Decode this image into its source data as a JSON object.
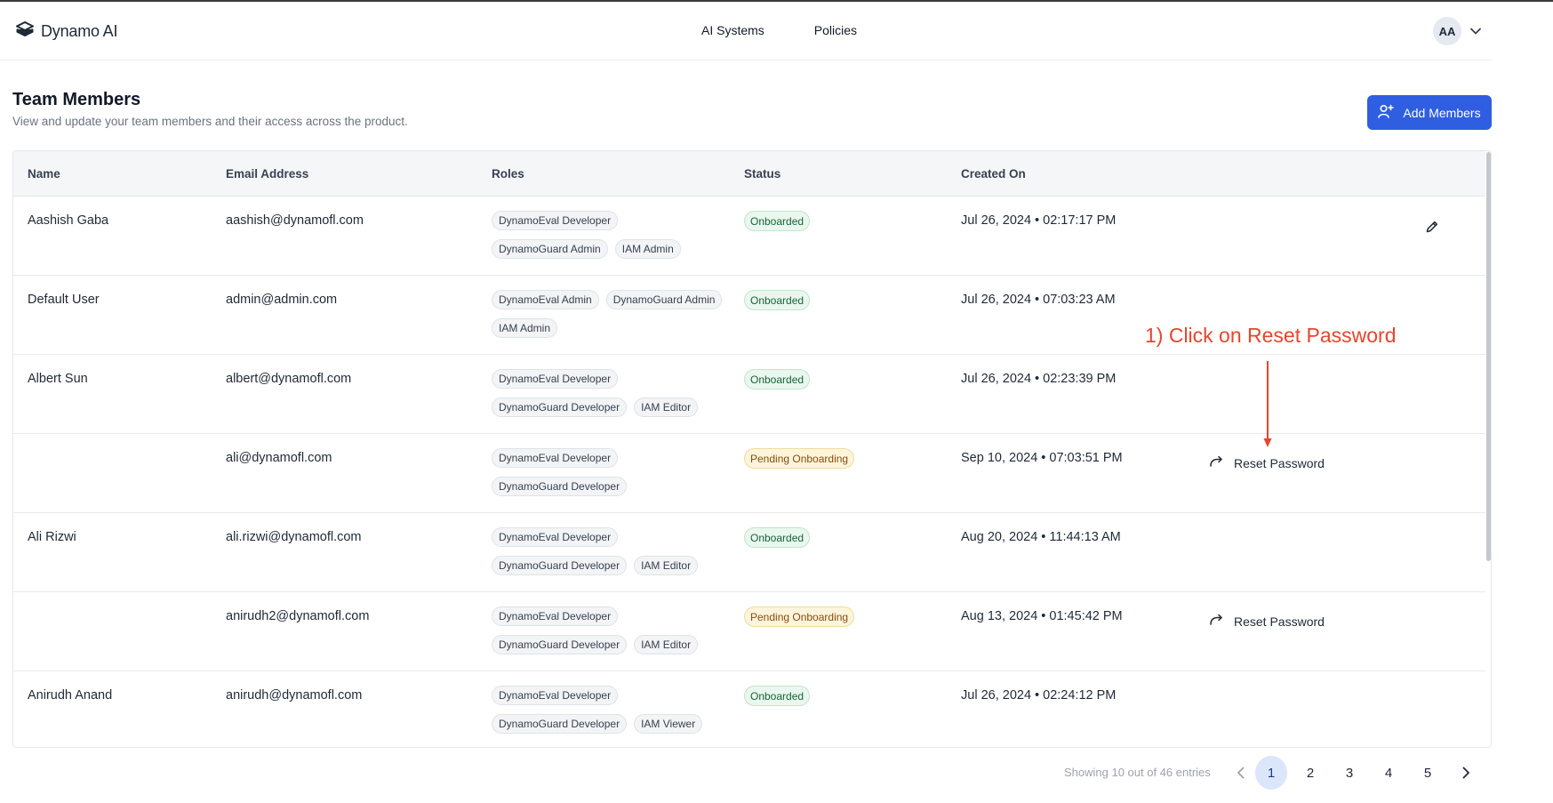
{
  "header": {
    "brand": "Dynamo AI",
    "nav": [
      "AI Systems",
      "Policies"
    ],
    "user_initials": "AA"
  },
  "page": {
    "title": "Team Members",
    "subtitle": "View and update your team members and their access across the product.",
    "add_button": "Add Members"
  },
  "table": {
    "columns": [
      "Name",
      "Email Address",
      "Roles",
      "Status",
      "Created On"
    ],
    "rows": [
      {
        "name": "Aashish Gaba",
        "email": "aashish@dynamofl.com",
        "roles": [
          "DynamoEval Developer",
          "DynamoGuard Admin",
          "IAM Admin"
        ],
        "status": "Onboarded",
        "created": "Jul 26, 2024 • 02:17:17 PM",
        "action": "edit"
      },
      {
        "name": "Default User",
        "email": "admin@admin.com",
        "roles": [
          "DynamoEval Admin",
          "DynamoGuard Admin",
          "IAM Admin"
        ],
        "status": "Onboarded",
        "created": "Jul 26, 2024 • 07:03:23 AM",
        "action": ""
      },
      {
        "name": "Albert Sun",
        "email": "albert@dynamofl.com",
        "roles": [
          "DynamoEval Developer",
          "DynamoGuard Developer",
          "IAM Editor"
        ],
        "status": "Onboarded",
        "created": "Jul 26, 2024 • 02:23:39 PM",
        "action": ""
      },
      {
        "name": "",
        "email": "ali@dynamofl.com",
        "roles": [
          "DynamoEval Developer",
          "DynamoGuard Developer"
        ],
        "status": "Pending Onboarding",
        "created": "Sep 10, 2024 • 07:03:51 PM",
        "action": "Reset Password"
      },
      {
        "name": "Ali Rizwi",
        "email": "ali.rizwi@dynamofl.com",
        "roles": [
          "DynamoEval Developer",
          "DynamoGuard Developer",
          "IAM Editor"
        ],
        "status": "Onboarded",
        "created": "Aug 20, 2024 • 11:44:13 AM",
        "action": ""
      },
      {
        "name": "",
        "email": "anirudh2@dynamofl.com",
        "roles": [
          "DynamoEval Developer",
          "DynamoGuard Developer",
          "IAM Editor"
        ],
        "status": "Pending Onboarding",
        "created": "Aug 13, 2024 • 01:45:42 PM",
        "action": "Reset Password"
      },
      {
        "name": "Anirudh Anand",
        "email": "anirudh@dynamofl.com",
        "roles": [
          "DynamoEval Developer",
          "DynamoGuard Developer",
          "IAM Viewer"
        ],
        "status": "Onboarded",
        "created": "Jul 26, 2024 • 02:24:12 PM",
        "action": ""
      }
    ]
  },
  "annotation": {
    "text": "1) Click on Reset Password",
    "color": "#e8452c"
  },
  "pagination": {
    "summary": "Showing 10 out of 46 entries",
    "pages": [
      "1",
      "2",
      "3",
      "4",
      "5"
    ],
    "current": "1"
  },
  "colors": {
    "primary": "#2f5ee0",
    "onboarded": "#166534",
    "pending": "#854d0e"
  },
  "icons": {
    "logo": "dynamo-logo-icon",
    "user_menu": "chevron-down-icon",
    "add_member": "user-plus-icon",
    "edit": "pencil-icon",
    "reset": "reset-arrow-icon",
    "prev": "chevron-left-icon",
    "next": "chevron-right-icon"
  }
}
